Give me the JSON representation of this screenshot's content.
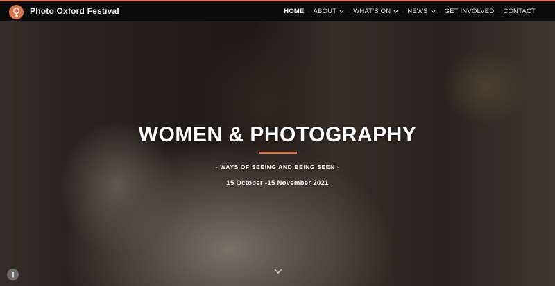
{
  "header": {
    "site_title": "Photo Oxford Festival",
    "logo_icon": "lens-pin-icon",
    "accent_color": "#d9734a",
    "separator": "·",
    "nav": [
      {
        "label": "Home",
        "active": true
      },
      {
        "label": "About",
        "dropdown": true
      },
      {
        "label": "What's On",
        "dropdown": true
      },
      {
        "label": "News",
        "dropdown": true
      },
      {
        "label": "Get Involved"
      },
      {
        "label": "Contact"
      }
    ]
  },
  "hero": {
    "title": "WOMEN & PHOTOGRAPHY",
    "subtitle": "- WAYS OF SEEING AND BEING SEEN -",
    "dates": "15 October -15 November 2021",
    "scroll_icon": "chevron-down-icon",
    "accessibility_icon": "accessibility-icon"
  }
}
